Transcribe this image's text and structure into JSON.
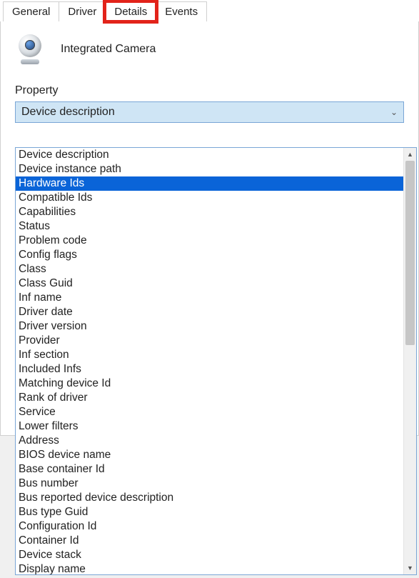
{
  "tabs": {
    "general": "General",
    "driver": "Driver",
    "details": "Details",
    "events": "Events",
    "active": "details",
    "highlighted": "details"
  },
  "device": {
    "name": "Integrated Camera"
  },
  "property": {
    "label": "Property",
    "selected": "Device description"
  },
  "dropdown": {
    "selected_index": 2,
    "options": [
      "Device description",
      "Device instance path",
      "Hardware Ids",
      "Compatible Ids",
      "Capabilities",
      "Status",
      "Problem code",
      "Config flags",
      "Class",
      "Class Guid",
      "Inf name",
      "Driver date",
      "Driver version",
      "Provider",
      "Inf section",
      "Included Infs",
      "Matching device Id",
      "Rank of driver",
      "Service",
      "Lower filters",
      "Address",
      "BIOS device name",
      "Base container Id",
      "Bus number",
      "Bus reported device description",
      "Bus type Guid",
      "Configuration Id",
      "Container Id",
      "Device stack",
      "Display name"
    ]
  }
}
